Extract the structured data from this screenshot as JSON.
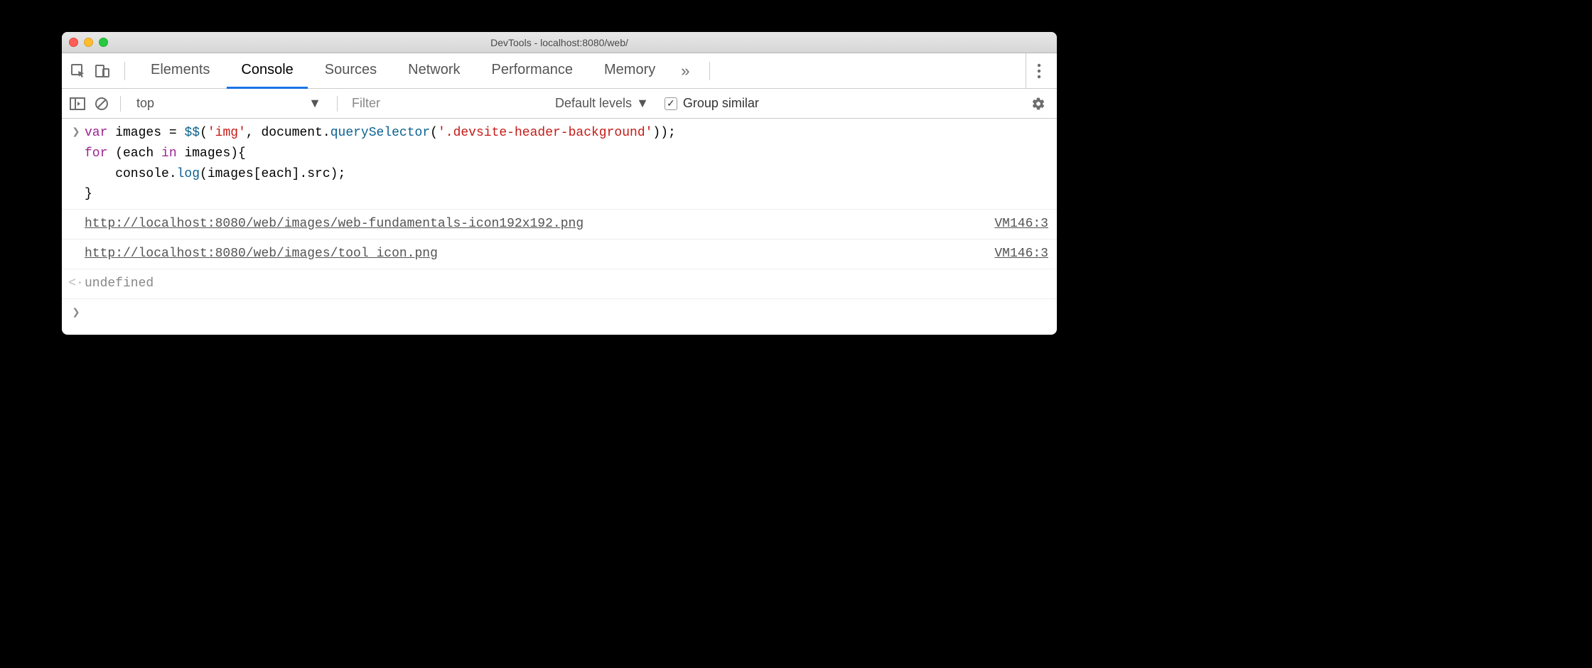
{
  "window": {
    "title": "DevTools - localhost:8080/web/"
  },
  "tabs": {
    "elements": "Elements",
    "console": "Console",
    "sources": "Sources",
    "network": "Network",
    "performance": "Performance",
    "memory": "Memory",
    "more": "»"
  },
  "toolbar": {
    "context": "top",
    "filter_placeholder": "Filter",
    "levels": "Default levels",
    "group_similar": "Group similar",
    "group_similar_checked": true
  },
  "console_input": {
    "tokens": [
      {
        "c": "kw",
        "t": "var"
      },
      {
        "c": "pln",
        "t": " images "
      },
      {
        "c": "pln",
        "t": "="
      },
      {
        "c": "pln",
        "t": " "
      },
      {
        "c": "fn",
        "t": "$$"
      },
      {
        "c": "pln",
        "t": "("
      },
      {
        "c": "str",
        "t": "'img'"
      },
      {
        "c": "pln",
        "t": ", document."
      },
      {
        "c": "fn",
        "t": "querySelector"
      },
      {
        "c": "pln",
        "t": "("
      },
      {
        "c": "str",
        "t": "'.devsite-header-background'"
      },
      {
        "c": "pln",
        "t": "));\n"
      },
      {
        "c": "kw",
        "t": "for"
      },
      {
        "c": "pln",
        "t": " (each "
      },
      {
        "c": "kw",
        "t": "in"
      },
      {
        "c": "pln",
        "t": " images){\n    console."
      },
      {
        "c": "fn",
        "t": "log"
      },
      {
        "c": "pln",
        "t": "(images[each].src);\n}"
      }
    ]
  },
  "console_logs": [
    {
      "text": "http://localhost:8080/web/images/web-fundamentals-icon192x192.png",
      "source": "VM146:3"
    },
    {
      "text": "http://localhost:8080/web/images/tool_icon.png",
      "source": "VM146:3"
    }
  ],
  "return_value": "undefined"
}
